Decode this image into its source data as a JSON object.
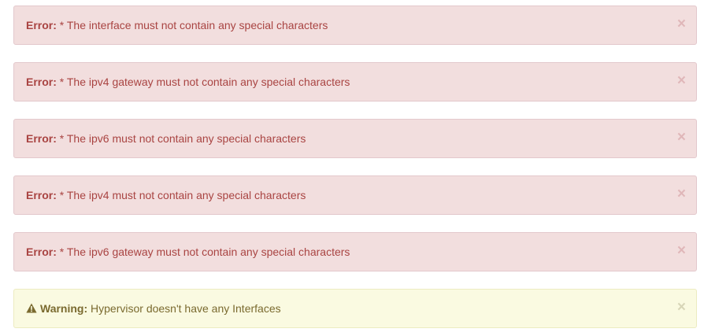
{
  "alerts": [
    {
      "type": "error",
      "label": "Error:",
      "message": "* The interface must not contain any special characters",
      "close": "×"
    },
    {
      "type": "error",
      "label": "Error:",
      "message": "* The ipv4 gateway must not contain any special characters",
      "close": "×"
    },
    {
      "type": "error",
      "label": "Error:",
      "message": "* The ipv6 must not contain any special characters",
      "close": "×"
    },
    {
      "type": "error",
      "label": "Error:",
      "message": "* The ipv4 must not contain any special characters",
      "close": "×"
    },
    {
      "type": "error",
      "label": "Error:",
      "message": "* The ipv6 gateway must not contain any special characters",
      "close": "×"
    },
    {
      "type": "warning",
      "icon": "warning-triangle-icon",
      "label": "Warning:",
      "message": "Hypervisor doesn't have any Interfaces",
      "close": "×"
    }
  ],
  "colors": {
    "error_bg": "#f2dede",
    "error_text": "#a94442",
    "warning_bg": "#fafae1",
    "warning_text": "#7a6a2f"
  }
}
